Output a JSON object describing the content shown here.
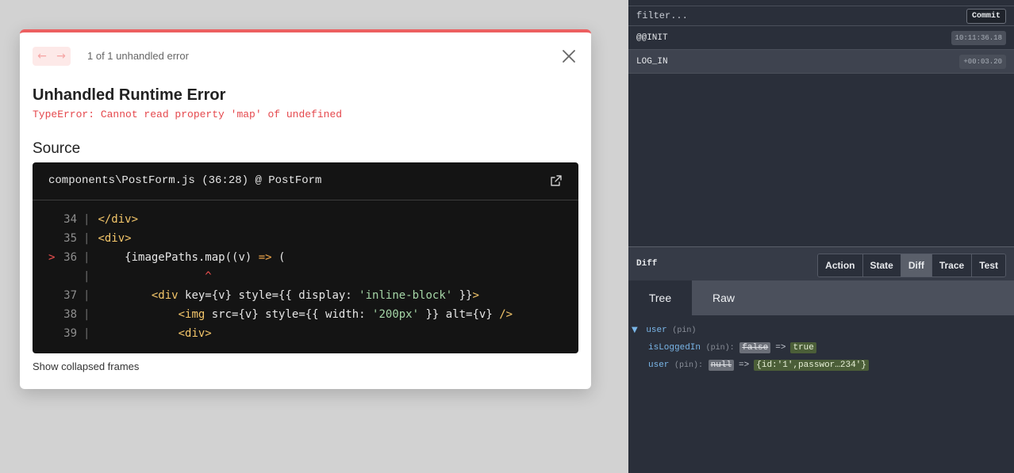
{
  "overlay": {
    "count_text": "1 of 1 unhandled error",
    "title": "Unhandled Runtime Error",
    "message": "TypeError: Cannot read property 'map' of undefined",
    "source_heading": "Source",
    "file_ref": "components\\PostForm.js (36:28) @ PostForm",
    "collapsed_link": "Show collapsed frames",
    "accent_color": "#ec5f60",
    "icons": [
      "arrow-left-icon",
      "arrow-right-icon",
      "close-icon",
      "external-link-icon"
    ]
  },
  "code_lines": [
    {
      "num": "34",
      "marker": "",
      "tokens": [
        {
          "t": "</div>",
          "c": "tok-tag"
        }
      ]
    },
    {
      "num": "35",
      "marker": "",
      "tokens": [
        {
          "t": "<div>",
          "c": "tok-tag"
        }
      ]
    },
    {
      "num": "36",
      "marker": ">",
      "tokens": [
        {
          "t": "    {imagePaths.map((v) ",
          "c": ""
        },
        {
          "t": "=>",
          "c": "tok-op"
        },
        {
          "t": " (",
          "c": ""
        }
      ]
    },
    {
      "num": "",
      "marker": "",
      "tokens": [
        {
          "t": "                ^",
          "c": "tok-caret"
        }
      ]
    },
    {
      "num": "37",
      "marker": "",
      "tokens": [
        {
          "t": "        ",
          "c": ""
        },
        {
          "t": "<div",
          "c": "tok-tag"
        },
        {
          "t": " key={v} style={{ display: ",
          "c": ""
        },
        {
          "t": "'inline-block'",
          "c": "tok-str"
        },
        {
          "t": " }}",
          "c": ""
        },
        {
          "t": ">",
          "c": "tok-tag"
        }
      ]
    },
    {
      "num": "38",
      "marker": "",
      "tokens": [
        {
          "t": "            ",
          "c": ""
        },
        {
          "t": "<img",
          "c": "tok-tag"
        },
        {
          "t": " src={v} style={{ width: ",
          "c": ""
        },
        {
          "t": "'200px'",
          "c": "tok-str"
        },
        {
          "t": " }} alt={v} ",
          "c": ""
        },
        {
          "t": "/>",
          "c": "tok-tag"
        }
      ]
    },
    {
      "num": "39",
      "marker": "",
      "tokens": [
        {
          "t": "            ",
          "c": ""
        },
        {
          "t": "<div>",
          "c": "tok-tag"
        }
      ]
    }
  ],
  "devtools": {
    "filter_placeholder": "filter...",
    "commit_label": "Commit",
    "actions": [
      {
        "name": "@@INIT",
        "time": "10:11:36.18",
        "selected": false
      },
      {
        "name": "LOG_IN",
        "time": "+00:03.20",
        "selected": true
      }
    ],
    "monitor_label": "Diff",
    "monitor_tabs": [
      {
        "label": "Action",
        "active": false
      },
      {
        "label": "State",
        "active": false
      },
      {
        "label": "Diff",
        "active": true
      },
      {
        "label": "Trace",
        "active": false
      },
      {
        "label": "Test",
        "active": false
      }
    ],
    "view_tabs": {
      "tree": "Tree",
      "raw": "Raw"
    },
    "tree": {
      "root_key": "user",
      "root_pin": "(pin)",
      "rows": [
        {
          "key": "isLoggedIn",
          "pin": "(pin):",
          "old": "false",
          "arrow": "=>",
          "new": "true"
        },
        {
          "key": "user",
          "pin": "(pin):",
          "old": "null",
          "arrow": "=>",
          "new": "{id:'1',passwor…234'}"
        }
      ]
    }
  }
}
